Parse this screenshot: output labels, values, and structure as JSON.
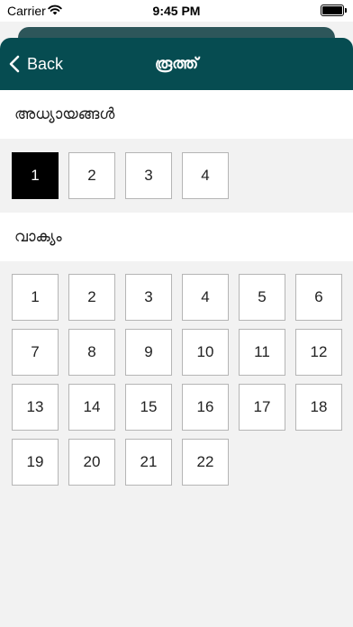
{
  "status_bar": {
    "carrier": "Carrier",
    "time": "9:45 PM"
  },
  "nav": {
    "back_label": "Back",
    "title": "രൂത്ത്"
  },
  "chapters": {
    "label": "അധ്യായങ്ങൾ",
    "items": [
      "1",
      "2",
      "3",
      "4"
    ],
    "selected": "1"
  },
  "verses": {
    "label": "വാക്യം",
    "items": [
      "1",
      "2",
      "3",
      "4",
      "5",
      "6",
      "7",
      "8",
      "9",
      "10",
      "11",
      "12",
      "13",
      "14",
      "15",
      "16",
      "17",
      "18",
      "19",
      "20",
      "21",
      "22"
    ]
  },
  "colors": {
    "nav_bg": "#064c51",
    "selected_bg": "#000000"
  }
}
